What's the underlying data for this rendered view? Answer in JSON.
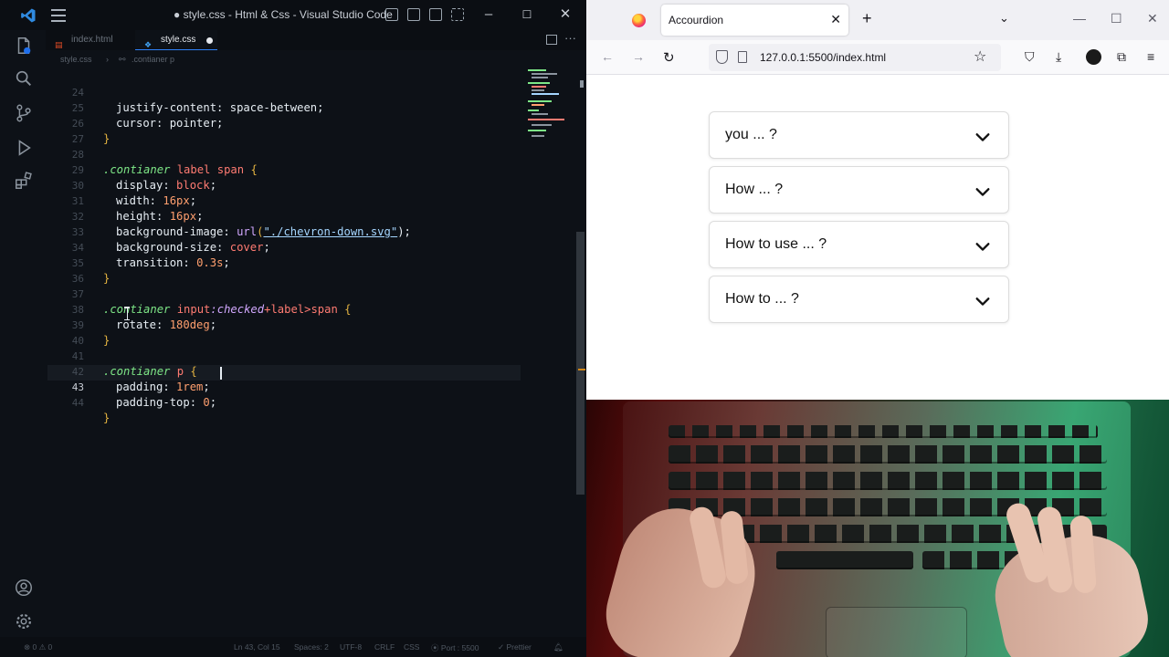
{
  "vscode": {
    "window_title": "● style.css - Html & Css - Visual Studio Code",
    "tabs": [
      {
        "label": "index.html",
        "icon": "html-file-icon",
        "active": false
      },
      {
        "label": "style.css",
        "icon": "css-file-icon",
        "active": true,
        "modified": true
      }
    ],
    "breadcrumb": [
      "style.css",
      ".contianer p"
    ],
    "code_lines": [
      {
        "n": "24"
      },
      {
        "n": "25"
      },
      {
        "n": "26"
      },
      {
        "n": "27"
      },
      {
        "n": "28"
      },
      {
        "n": "29"
      },
      {
        "n": "30"
      },
      {
        "n": "31"
      },
      {
        "n": "32"
      },
      {
        "n": "33"
      },
      {
        "n": "34"
      },
      {
        "n": "35"
      },
      {
        "n": "36"
      },
      {
        "n": "37"
      },
      {
        "n": "38"
      },
      {
        "n": "39"
      },
      {
        "n": "40"
      },
      {
        "n": "41"
      },
      {
        "n": "42"
      },
      {
        "n": "43"
      },
      {
        "n": "44"
      }
    ],
    "code": {
      "l24": "justify-content: space-between;",
      "l25": "cursor: pointer;",
      "l26": "}",
      "l28_sel": ".contianer",
      "l28_rest": " label span ",
      "l29_p": "display: ",
      "l29_v": "block",
      "l29_e": ";",
      "l30_p": "width: ",
      "l30_v": "16px",
      "l30_e": ";",
      "l31_p": "height: ",
      "l31_v": "16px",
      "l31_e": ";",
      "l32_p": "background-image: ",
      "l32_fn": "url",
      "l32_s": "\"./chevron-down.svg\"",
      "l32_e": ");",
      "l33_p": "background-size: ",
      "l33_v": "cover",
      "l33_e": ";",
      "l34_p": "transition: ",
      "l34_v": "0.3s",
      "l34_e": ";",
      "l35": "}",
      "l37_sel": ".contianer",
      "l37_tag": " input",
      "l37_pseudo": ":checked",
      "l37_rest": "+label>span ",
      "l38_p": "rotate: ",
      "l38_v": "180deg",
      "l38_e": ";",
      "l39": "}",
      "l41_sel": ".contianer",
      "l41_tag": " p ",
      "l42_p": "padding: ",
      "l42_v": "1rem",
      "l42_e": ";",
      "l43_p": "padding-top: ",
      "l43_v": "0",
      "l43_e": ";",
      "l44": "}"
    },
    "status": {
      "errors": "⊗ 0 ⚠ 0",
      "position": "Ln 43, Col 15",
      "spaces": "Spaces: 2",
      "encoding": "UTF-8",
      "eol": "CRLF",
      "language": "CSS",
      "port": "⦿ Port : 5500",
      "prettier": "✓ Prettier"
    }
  },
  "firefox": {
    "tab_title": "Accourdion",
    "url": "127.0.0.1:5500/index.html",
    "accordion": [
      {
        "label": "you ... ?"
      },
      {
        "label": "How ... ?"
      },
      {
        "label": "How to use ... ?"
      },
      {
        "label": "How to ... ?"
      }
    ]
  },
  "colors": {
    "editor_bg": "#0d1117",
    "selector": "#7ee787",
    "keyword": "#ff7b72",
    "brace": "#e3b341",
    "browser_tab_bg": "#f0f0f4"
  }
}
